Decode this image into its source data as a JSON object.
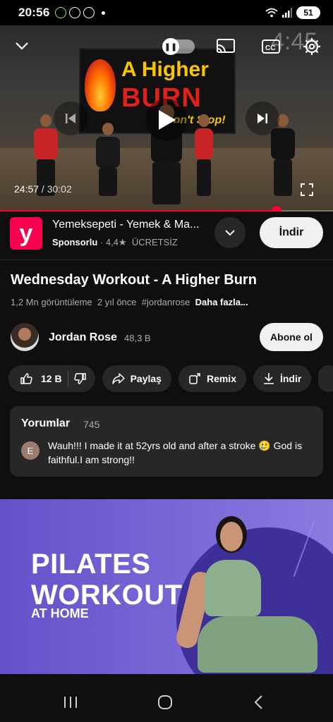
{
  "status_bar": {
    "time": "20:56",
    "battery": "51"
  },
  "player": {
    "remaining_overlay": "4:45",
    "current_time": "24:57",
    "separator": " / ",
    "duration": "30:02",
    "progress_fraction": 0.831,
    "accent_color": "#ff0033",
    "thumbnail_text": {
      "line1": "A Higher",
      "line2": "BURN",
      "line3": "Don't Stop!"
    }
  },
  "ad": {
    "logo_letter": "y",
    "title": "Yemeksepeti - Yemek & Ma...",
    "sponsored": "Sponsorlu",
    "rating": "4,4★",
    "price": "ÜCRETSİZ",
    "install_label": "İndir",
    "brand_color": "#fa0050"
  },
  "video": {
    "title": "Wednesday Workout - A Higher Burn",
    "views": "1,2 Mn görüntüleme",
    "age": "2 yıl önce",
    "hashtag": "#jordanrose",
    "more": "Daha fazla..."
  },
  "channel": {
    "name": "Jordan Rose",
    "subscribers": "48,3 B",
    "subscribe_label": "Abone ol"
  },
  "actions": {
    "likes": "12 B",
    "share": "Paylaş",
    "remix": "Remix",
    "download": "İndir"
  },
  "comments": {
    "header": "Yorumlar",
    "count": "745",
    "top_initial": "E",
    "top_text": "Wauh!!! I made it at 52yrs old and after a stroke 🥲 God is faithful.I am strong!!"
  },
  "promo": {
    "line1": "PILATES",
    "line2": "WORKOUT",
    "line3": "AT HOME"
  }
}
